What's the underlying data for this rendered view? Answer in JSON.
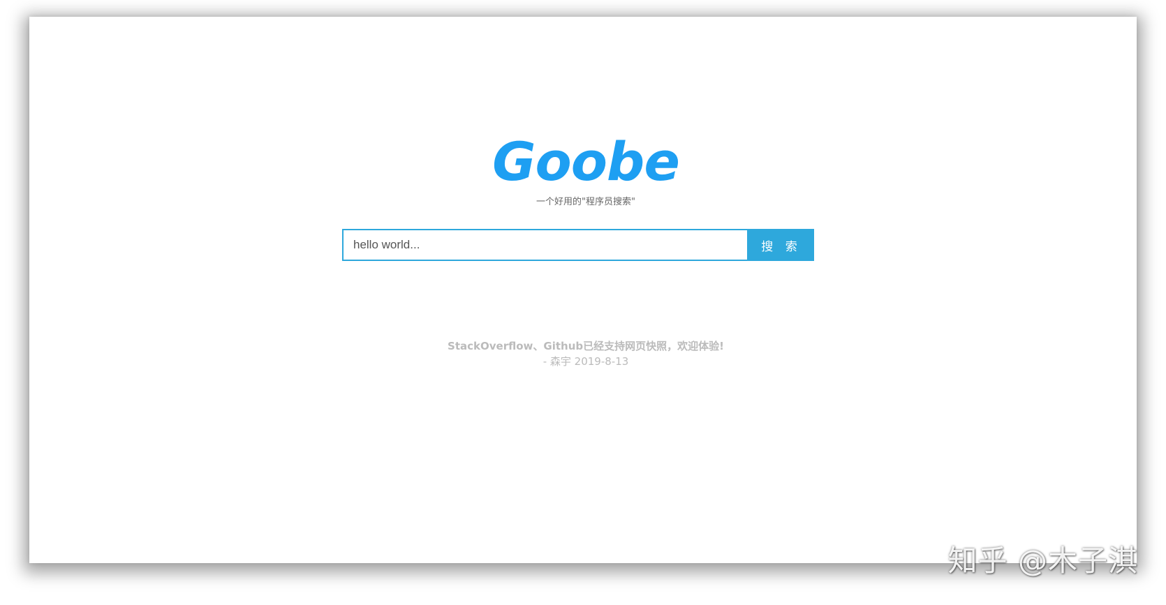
{
  "brand": {
    "logo_text": "Goobe",
    "logo_color": "#1e9ff2",
    "tagline": "一个好用的\"程序员搜索\""
  },
  "search": {
    "placeholder": "hello world...",
    "value": "",
    "button_label": "搜 索",
    "accent_color": "#2ea8dc"
  },
  "announcement": {
    "message": "StackOverflow、Github已经支持网页快照，欢迎体验!",
    "signature": "- 森宇 2019-8-13"
  },
  "watermark": {
    "text": "知乎 @木子淇"
  }
}
